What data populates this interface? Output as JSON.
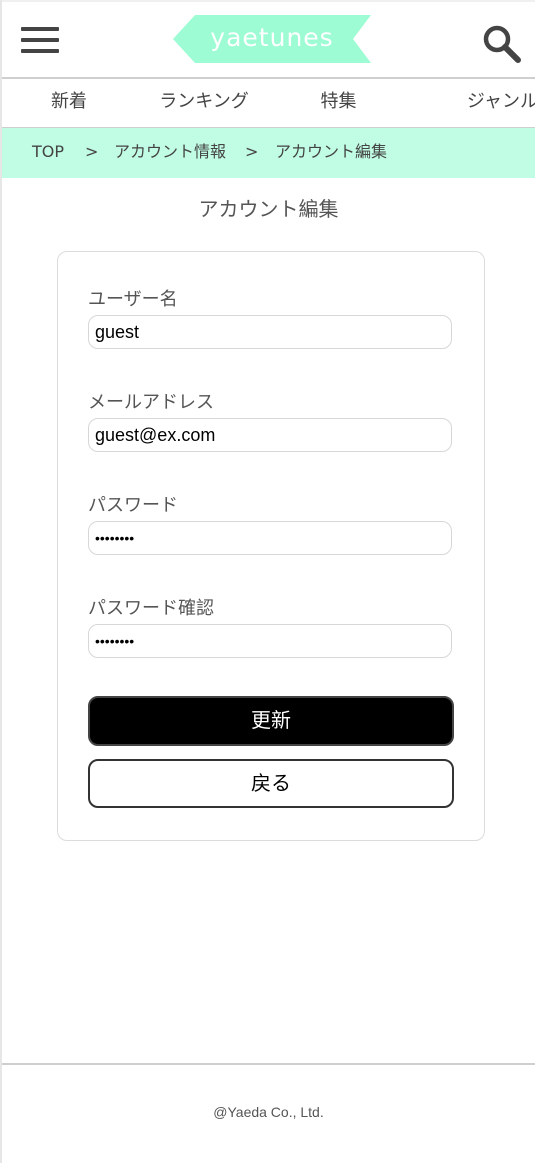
{
  "header": {
    "logo_text": "yaetunes",
    "menu_icon": "hamburger-menu-icon",
    "search_icon": "search-icon",
    "logo_color": "#9dfcd3"
  },
  "nav": {
    "items": [
      {
        "label": "新着"
      },
      {
        "label": "ランキング"
      },
      {
        "label": "特集"
      },
      {
        "label": "ジャンル"
      }
    ]
  },
  "breadcrumb": {
    "items": [
      "TOP",
      "アカウント情報",
      "アカウント編集"
    ],
    "separator": ">",
    "background": "#c1fde4"
  },
  "page": {
    "title": "アカウント編集"
  },
  "form": {
    "username": {
      "label": "ユーザー名",
      "value": "guest"
    },
    "email": {
      "label": "メールアドレス",
      "value": "guest@ex.com"
    },
    "password": {
      "label": "パスワード",
      "value": "••••••••"
    },
    "password_confirm": {
      "label": "パスワード確認",
      "value": "••••••••"
    },
    "update_label": "更新",
    "back_label": "戻る"
  },
  "footer": {
    "copyright": "@Yaeda Co., Ltd."
  }
}
